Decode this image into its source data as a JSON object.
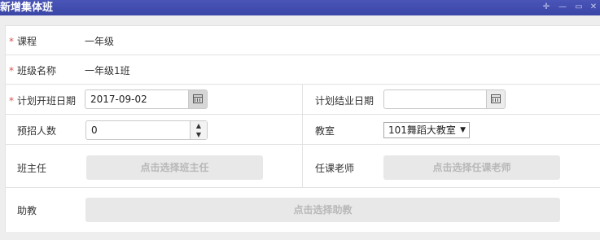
{
  "window": {
    "title": "新增集体班",
    "controls": [
      "✛",
      "—",
      "▭",
      "✕"
    ]
  },
  "form": {
    "course": {
      "label": "课程",
      "value": "一年级"
    },
    "class_name": {
      "label": "班级名称",
      "value": "一年级1班"
    },
    "start_date": {
      "label": "计划开班日期",
      "value": "2017-09-02"
    },
    "end_date": {
      "label": "计划结业日期",
      "value": ""
    },
    "enrollment": {
      "label": "预招人数",
      "value": "0"
    },
    "classroom": {
      "label": "教室",
      "value": "101舞蹈大教室",
      "arrow": "▼"
    },
    "head_teacher": {
      "label": "班主任",
      "button": "点击选择班主任"
    },
    "teacher": {
      "label": "任课老师",
      "button": "点击选择任课老师"
    },
    "assistant": {
      "label": "助教",
      "button": "点击选择助教"
    },
    "required_mark": "*",
    "spin_up": "▲",
    "spin_down": "▼"
  },
  "colors": {
    "titlebar": "#3f4bb0",
    "required": "#d9534f",
    "button_bg": "#e8e8e8",
    "button_text": "#b8b8b8"
  },
  "icons": [
    "calendar-icon",
    "spin-up-icon",
    "spin-down-icon",
    "dropdown-arrow-icon"
  ]
}
